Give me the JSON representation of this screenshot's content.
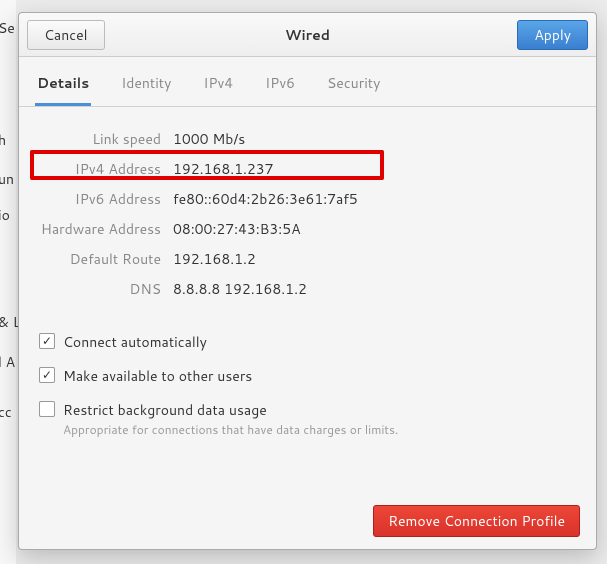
{
  "bg": {
    "t1": "Se",
    "t2": "h",
    "t3": "un",
    "t4": "io",
    "t5": "& L",
    "t6": "l A",
    "t7": "cc"
  },
  "header": {
    "cancel": "Cancel",
    "title": "Wired",
    "apply": "Apply"
  },
  "tabs": [
    {
      "label": "Details",
      "active": true
    },
    {
      "label": "Identity"
    },
    {
      "label": "IPv4"
    },
    {
      "label": "IPv6"
    },
    {
      "label": "Security"
    }
  ],
  "details": {
    "link_speed": {
      "label": "Link speed",
      "value": "1000 Mb/s"
    },
    "ipv4": {
      "label": "IPv4 Address",
      "value": "192.168.1.237"
    },
    "ipv6": {
      "label": "IPv6 Address",
      "value": "fe80::60d4:2b26:3e61:7af5"
    },
    "hw": {
      "label": "Hardware Address",
      "value": "08:00:27:43:B3:5A"
    },
    "route": {
      "label": "Default Route",
      "value": "192.168.1.2"
    },
    "dns": {
      "label": "DNS",
      "value": "8.8.8.8 192.168.1.2"
    }
  },
  "checks": {
    "auto": {
      "label": "Connect automatically",
      "checked": true
    },
    "shared": {
      "label": "Make available to other users",
      "checked": true
    },
    "restrict": {
      "label": "Restrict background data usage",
      "sub": "Appropriate for connections that have data charges or limits.",
      "checked": false
    }
  },
  "footer": {
    "remove": "Remove Connection Profile"
  }
}
